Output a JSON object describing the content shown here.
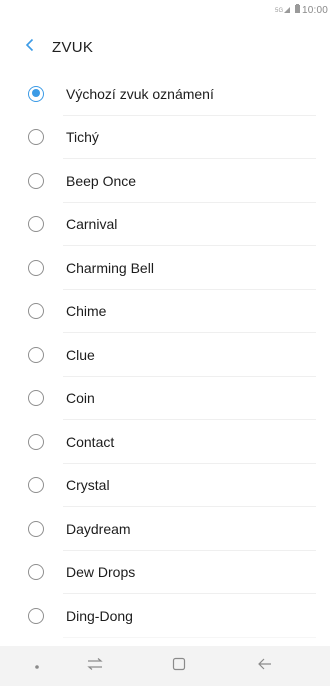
{
  "status_bar": {
    "signal_icon": "signal-icon",
    "battery_icon": "battery-icon",
    "time": "10:00"
  },
  "header": {
    "back_icon": "chevron-left-icon",
    "title": "ZVUK"
  },
  "sounds": {
    "selected_index": 0,
    "items": [
      {
        "label": "Výchozí zvuk oznámení"
      },
      {
        "label": "Tichý"
      },
      {
        "label": "Beep Once"
      },
      {
        "label": "Carnival"
      },
      {
        "label": "Charming Bell"
      },
      {
        "label": "Chime"
      },
      {
        "label": "Clue"
      },
      {
        "label": "Coin"
      },
      {
        "label": "Contact"
      },
      {
        "label": "Crystal"
      },
      {
        "label": "Daydream"
      },
      {
        "label": "Dew Drops"
      },
      {
        "label": "Ding-Dong"
      }
    ]
  },
  "navbar": {
    "items": [
      "dot-icon",
      "recent-apps-icon",
      "home-icon",
      "back-arrow-icon"
    ]
  },
  "colors": {
    "accent": "#3c9be6",
    "radio_border": "#8f8f8f",
    "navbar_bg": "#f3f3f3"
  }
}
